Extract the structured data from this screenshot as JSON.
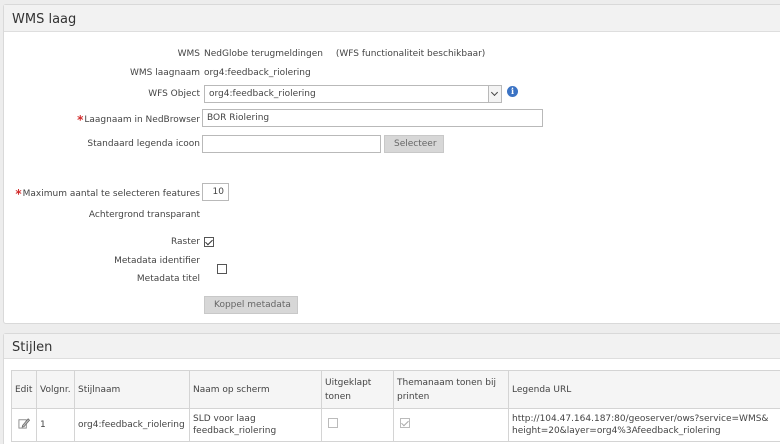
{
  "wms_panel": {
    "title": "WMS laag",
    "wms": {
      "label": "WMS",
      "value": "NedGlobe terugmeldingen",
      "note": "(WFS functionaliteit beschikbaar)"
    },
    "wms_layer": {
      "label": "WMS laagnaam",
      "value": "org4:feedback_riolering"
    },
    "wfs_object": {
      "label": "WFS Object",
      "value": "org4:feedback_riolering"
    },
    "layer_name": {
      "label": "Laagnaam in NedBrowser",
      "value": "BOR Riolering",
      "required": "*"
    },
    "legend_icon": {
      "label": "Standaard legenda icoon",
      "value": "",
      "button": "Selecteer"
    },
    "max_features": {
      "label": "Maximum aantal te selecteren features",
      "value": "10",
      "required": "*"
    },
    "transparent": {
      "label": "Achtergrond transparant",
      "checked": true
    },
    "raster": {
      "label": "Raster",
      "checked": false
    },
    "metadata_identifier": {
      "label": "Metadata identifier"
    },
    "metadata_title": {
      "label": "Metadata titel"
    },
    "link_metadata_button": "Koppel metadata"
  },
  "styles_panel": {
    "title": "Stijlen",
    "columns": {
      "edit": "Edit",
      "order": "Volgnr.",
      "style_name": "Stijlnaam",
      "screen_name": "Naam op scherm",
      "expanded_line1": "Uitgeklapt",
      "expanded_line2": "tonen",
      "theme_line1": "Themanaam tonen bij",
      "theme_line2": "printen",
      "legend_url": "Legenda URL"
    },
    "rows": [
      {
        "order": "1",
        "style_name": "org4:feedback_riolering",
        "screen_name_line1": "SLD voor laag",
        "screen_name_line2": "feedback_riolering",
        "expanded": false,
        "theme_name": true,
        "legend_url_line1": "http://104.47.164.187:80/geoserver/ows?service=WMS&",
        "legend_url_line2": "height=20&layer=org4%3Afeedback_riolering"
      }
    ]
  },
  "icons": {
    "info": "info-icon",
    "edit": "edit-pencil-icon",
    "dropdown": "chevron-down-icon"
  },
  "colors": {
    "required": "#d12b2b",
    "info": "#3b73c4",
    "header_bg": "#f2f2f2"
  }
}
